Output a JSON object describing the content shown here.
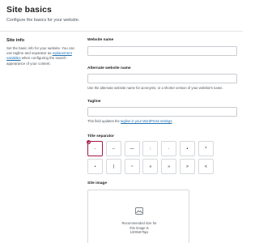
{
  "header": {
    "title": "Site basics",
    "subtitle": "Configure the basics for your website."
  },
  "sidebar": {
    "title": "Site info",
    "desc_part1": "Set the basic info for your website. You can use tagline and separator as ",
    "desc_link": "replacement variables",
    "desc_part2": " when configuring the search appearance of your content."
  },
  "form": {
    "website_name": {
      "label": "Website name",
      "value": ""
    },
    "alternate_name": {
      "label": "Alternate website name",
      "value": "",
      "help": "Use the alternate website name for acronyms, or a shorter version of your website's name."
    },
    "tagline": {
      "label": "Tagline",
      "value": "",
      "help_prefix": "This field updates the ",
      "help_link": "tagline in your WordPress settings",
      "help_suffix": "."
    },
    "title_separator": {
      "label": "Title separator",
      "selected_index": 0,
      "options": [
        "-",
        "–",
        "—",
        ":",
        "·",
        "•",
        "*",
        "⋆",
        "|",
        "~",
        "«",
        "»",
        ">",
        "<"
      ]
    },
    "site_image": {
      "label": "Site image",
      "line1": "Recommended size for",
      "line2": "this image is",
      "line3": "1200x675px"
    }
  },
  "colors": {
    "accent": "#a1184b",
    "link": "#2271b1",
    "border": "#d5d8dc",
    "muted_text": "#50575e"
  }
}
